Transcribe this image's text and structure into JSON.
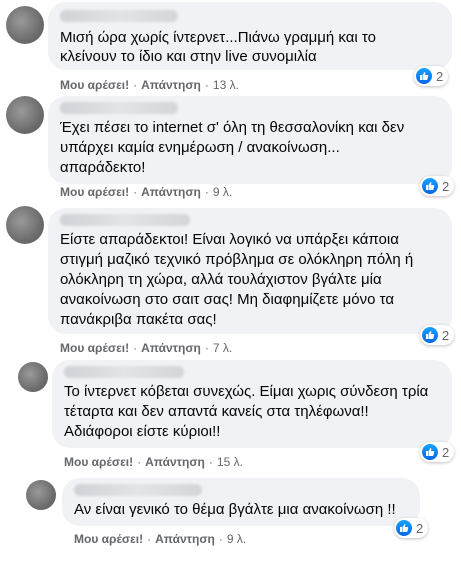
{
  "comments": [
    {
      "text_lines": [
        "Μισή ώρα χωρίς ίντερνετ...Πιάνω γραμμή και το",
        "κλείνουν το ίδιο και στην live συνομιλία"
      ],
      "like_label": "Μου αρέσει!",
      "reply_label": "Απάντηση",
      "time": "13 λ.",
      "reaction_count": "2",
      "reaction_icon": "like-icon"
    },
    {
      "text_lines": [
        "Έχει πέσει το internet σ' όλη τη θεσσαλονίκη και δεν",
        "υπάρχει καμία ενημέρωση / ανακοίνωση...",
        "απαράδεκτο!"
      ],
      "like_label": "Μου αρέσει!",
      "reply_label": "Απάντηση",
      "time": "9 λ.",
      "reaction_count": "2",
      "reaction_icon": "like-icon"
    },
    {
      "text_lines": [
        "Είστε απαράδεκτοι! Είναι λογικό να υπάρξει κάποια",
        "στιγμή μαζικό τεχνικό πρόβλημα σε ολόκληρη πόλη ή",
        "ολόκληρη τη χώρα, αλλά τουλάχιστον βγάλτε μία",
        "ανακοίνωση στο σαιτ σας! Μη διαφημίζετε μόνο τα",
        "πανάκριβα πακέτα σας!"
      ],
      "like_label": "Μου αρέσει!",
      "reply_label": "Απάντηση",
      "time": "7 λ.",
      "reaction_count": "2",
      "reaction_icon": "like-icon"
    },
    {
      "text_lines": [
        "Το ίντερνετ κόβεται συνεχώς. Είμαι χωρις σύνδεση τρία",
        "τέταρτα και δεν απαντά κανείς στα τηλέφωνα!!",
        "Αδιάφοροι είστε κύριοι!!"
      ],
      "like_label": "Μου αρέσει!",
      "reply_label": "Απάντηση",
      "time": "15 λ.",
      "reaction_count": "2",
      "reaction_icon": "like-icon"
    },
    {
      "text_lines": [
        "Αν είναι γενικό το θέμα βγάλτε μια ανακοίνωση !!"
      ],
      "like_label": "Μου αρέσει!",
      "reply_label": "Απάντηση",
      "time": "9 λ.",
      "reaction_count": "2",
      "reaction_icon": "like-icon"
    }
  ],
  "colors": {
    "bubble": "#f0f2f5",
    "meta_text": "#65676b",
    "like_blue": "#1877f2"
  }
}
